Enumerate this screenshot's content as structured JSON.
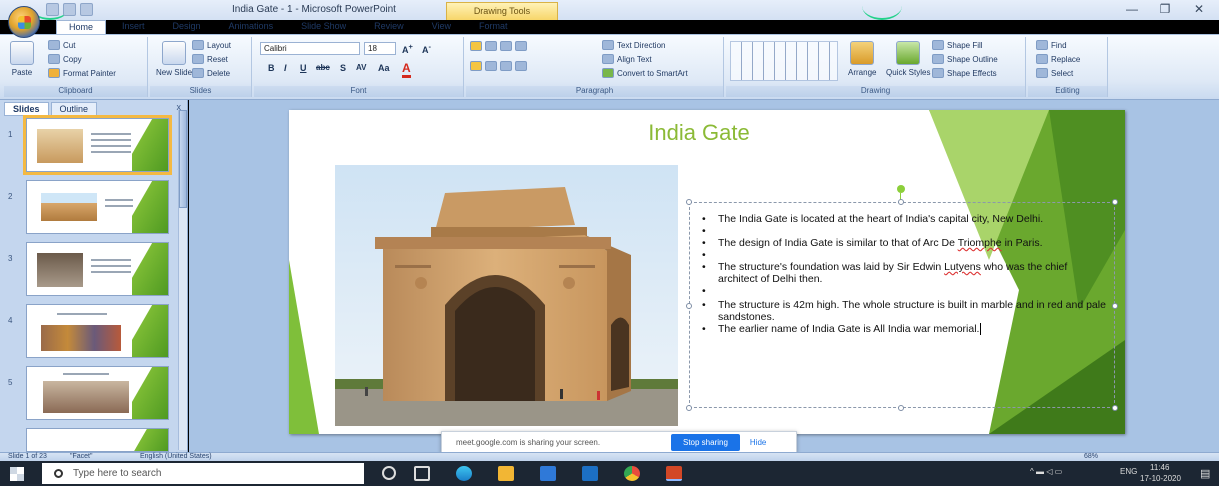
{
  "window": {
    "title": "India Gate - 1 - Microsoft PowerPoint",
    "contextual_tab": "Drawing Tools",
    "minimize": "—",
    "maximize": "❐",
    "close": "✕"
  },
  "ribbon": {
    "tabs": [
      "Home",
      "Insert",
      "Design",
      "Animations",
      "Slide Show",
      "Review",
      "View",
      "Format"
    ],
    "active_tab": "Home",
    "clipboard": {
      "label": "Clipboard",
      "paste": "Paste",
      "cut": "Cut",
      "copy": "Copy",
      "format_painter": "Format Painter"
    },
    "slides": {
      "label": "Slides",
      "new_slide": "New Slide",
      "layout": "Layout",
      "reset": "Reset",
      "delete": "Delete"
    },
    "font": {
      "label": "Font",
      "font_name": "Calibri",
      "font_size": "18",
      "bold": "B",
      "italic": "I",
      "underline": "U",
      "strike": "abc",
      "shadow": "S",
      "spacing": "AV",
      "case": "Aa",
      "color": "A"
    },
    "paragraph": {
      "label": "Paragraph",
      "text_direction": "Text Direction",
      "align_text": "Align Text",
      "convert": "Convert to SmartArt"
    },
    "drawing": {
      "label": "Drawing",
      "arrange": "Arrange",
      "quick_styles": "Quick Styles",
      "shape_fill": "Shape Fill",
      "shape_outline": "Shape Outline",
      "shape_effects": "Shape Effects"
    },
    "editing": {
      "label": "Editing",
      "find": "Find",
      "replace": "Replace",
      "select": "Select"
    }
  },
  "left_pane": {
    "tabs": [
      "Slides",
      "Outline"
    ],
    "active_tab": "Slides",
    "close": "x",
    "thumbnails": [
      {
        "num": "1",
        "selected": true
      },
      {
        "num": "2",
        "selected": false
      },
      {
        "num": "3",
        "selected": false
      },
      {
        "num": "4",
        "selected": false
      },
      {
        "num": "5",
        "selected": false
      }
    ]
  },
  "slide": {
    "title": "India Gate",
    "bullets": [
      {
        "text": "The India Gate is located at the heart of India's capital city, New Delhi."
      },
      {
        "text": ""
      },
      {
        "text": "The design of India Gate is similar to that of Arc De ",
        "underlined": "Triomphe",
        "after": " in Paris."
      },
      {
        "text": ""
      },
      {
        "text": "The structure's foundation was laid by Sir Edwin ",
        "underlined": "Lutyens",
        "after": " who was the chief architect of Delhi then."
      },
      {
        "text": ""
      },
      {
        "text": "The structure is 42m high. The whole structure is built in marble and in red and pale sandstones."
      },
      {
        "text": "The earlier name of India Gate is All India war memorial."
      }
    ]
  },
  "share_bar": {
    "message": "meet.google.com is sharing your screen.",
    "stop": "Stop sharing",
    "hide": "Hide"
  },
  "status_bar": {
    "slide_info": "Slide 1 of 23",
    "theme": "\"Facet\"",
    "language": "English (United States)",
    "zoom": "68%"
  },
  "taskbar": {
    "search_placeholder": "Type here to search",
    "time": "11:46",
    "date": "17-10-2020",
    "lang": "ENG"
  },
  "colors": {
    "title_green": "#8bba36",
    "accent_green": "#6aa82e",
    "selection_orange": "#f4b942",
    "ribbon_blue": "#dfe9f6",
    "stop_button_blue": "#1a73e8"
  }
}
